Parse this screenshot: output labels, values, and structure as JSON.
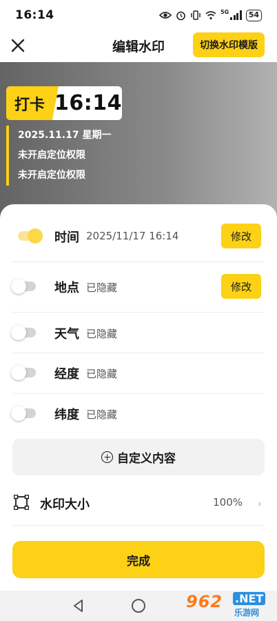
{
  "status_bar": {
    "time": "16:14",
    "network": "5G",
    "battery": "54"
  },
  "header": {
    "title": "编辑水印",
    "switch_template_label": "切换水印模版"
  },
  "preview": {
    "punch_label": "打卡",
    "time": "16:14",
    "lines": [
      "2025.11.17 星期一",
      "未开启定位权限",
      "未开启定位权限"
    ]
  },
  "fields": [
    {
      "label": "时间",
      "value": "2025/11/17 16:14",
      "enabled": true,
      "edit_label": "修改"
    },
    {
      "label": "地点",
      "value": "已隐藏",
      "enabled": false,
      "edit_label": "修改"
    },
    {
      "label": "天气",
      "value": "已隐藏",
      "enabled": false
    },
    {
      "label": "经度",
      "value": "已隐藏",
      "enabled": false
    },
    {
      "label": "纬度",
      "value": "已隐藏",
      "enabled": false
    }
  ],
  "custom_content_label": "自定义内容",
  "watermark_size": {
    "label": "水印大小",
    "value": "100%"
  },
  "done_label": "完成",
  "site_logo": {
    "main": "962",
    "net": ".NET",
    "sub": "乐游网"
  },
  "colors": {
    "accent": "#fcd116",
    "preview_bg": "#7a7a7a"
  }
}
